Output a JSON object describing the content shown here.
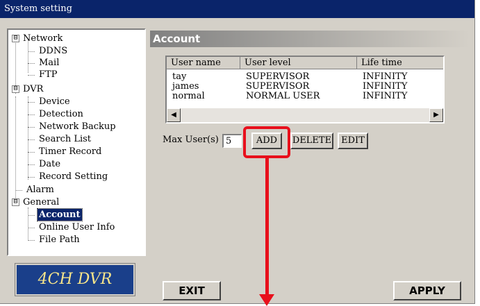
{
  "window": {
    "title": "System setting"
  },
  "tree": {
    "network": "Network",
    "ddns": "DDNS",
    "mail": "Mail",
    "ftp": "FTP",
    "dvr": "DVR",
    "device": "Device",
    "detection": "Detection",
    "network_backup": "Network Backup",
    "search_list": "Search List",
    "timer_record": "Timer Record",
    "date": "Date",
    "record_setting": "Record Setting",
    "alarm": "Alarm",
    "general": "General",
    "account": "Account",
    "online_user_info": "Online User Info",
    "file_path": "File Path",
    "expanded_glyph": "⊟"
  },
  "logo": {
    "text": "4CH DVR"
  },
  "section": {
    "title": "Account"
  },
  "user_table": {
    "columns": [
      "User name",
      "User level",
      "Life time"
    ],
    "rows": [
      [
        "tay",
        "SUPERVISOR",
        "INFINITY"
      ],
      [
        "james",
        "SUPERVISOR",
        "INFINITY"
      ],
      [
        "normal",
        "NORMAL USER",
        "INFINITY"
      ]
    ]
  },
  "max_users": {
    "label": "Max User(s) :",
    "value": "5"
  },
  "buttons": {
    "add": "ADD",
    "delete": "DELETE",
    "edit": "EDIT",
    "exit": "EXIT",
    "apply": "APPLY"
  },
  "scroll": {
    "left": "◀",
    "right": "▶"
  },
  "colors": {
    "title_bar": "#0a246a",
    "highlight": "#e8101c",
    "logo_bg": "#1a3f8a",
    "logo_text": "#f7e58a"
  }
}
